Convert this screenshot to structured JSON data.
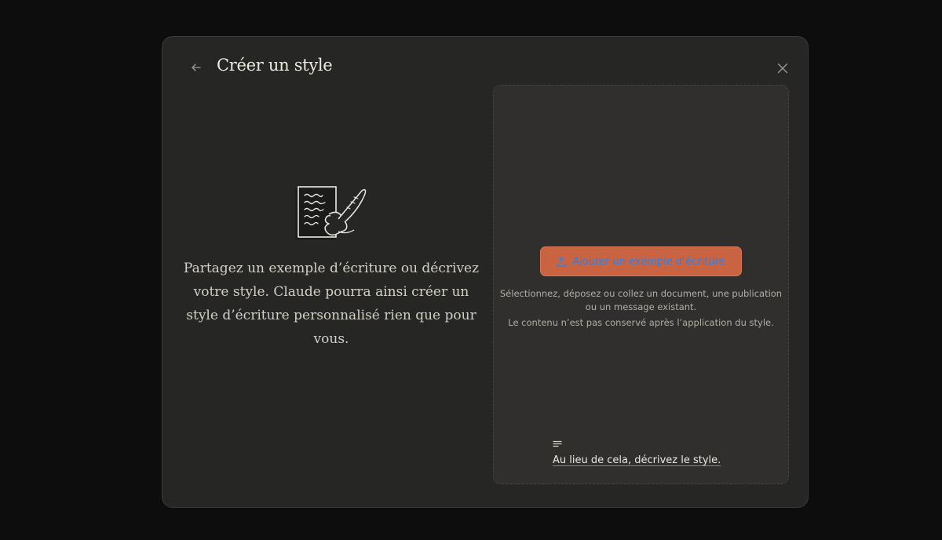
{
  "dialog": {
    "title": "Créer un style",
    "back_icon": "arrow-left-icon",
    "close_icon": "close-icon"
  },
  "intro": {
    "illustration": "writing-hand-document-icon",
    "text": "Partagez un exemple d’écriture ou décrivez votre style. Claude pourra ainsi créer un style d’écriture personnalisé rien que pour vous."
  },
  "upload": {
    "button_label": "Ajouter un exemple d’écriture",
    "button_icon": "upload-icon",
    "help_line_1": "Sélectionnez, déposez ou collez un document, une publication ou un message existant.",
    "help_line_2": "Le contenu n’est pas conservé après l’application du style."
  },
  "describe": {
    "icon": "text-lines-icon",
    "label": "Au lieu de cela, décrivez le style."
  },
  "colors": {
    "background": "#0d0d0d",
    "modal": "#262625",
    "dropzone": "#302f2d",
    "accent": "#c96442",
    "button_text": "#2f7fe6"
  }
}
